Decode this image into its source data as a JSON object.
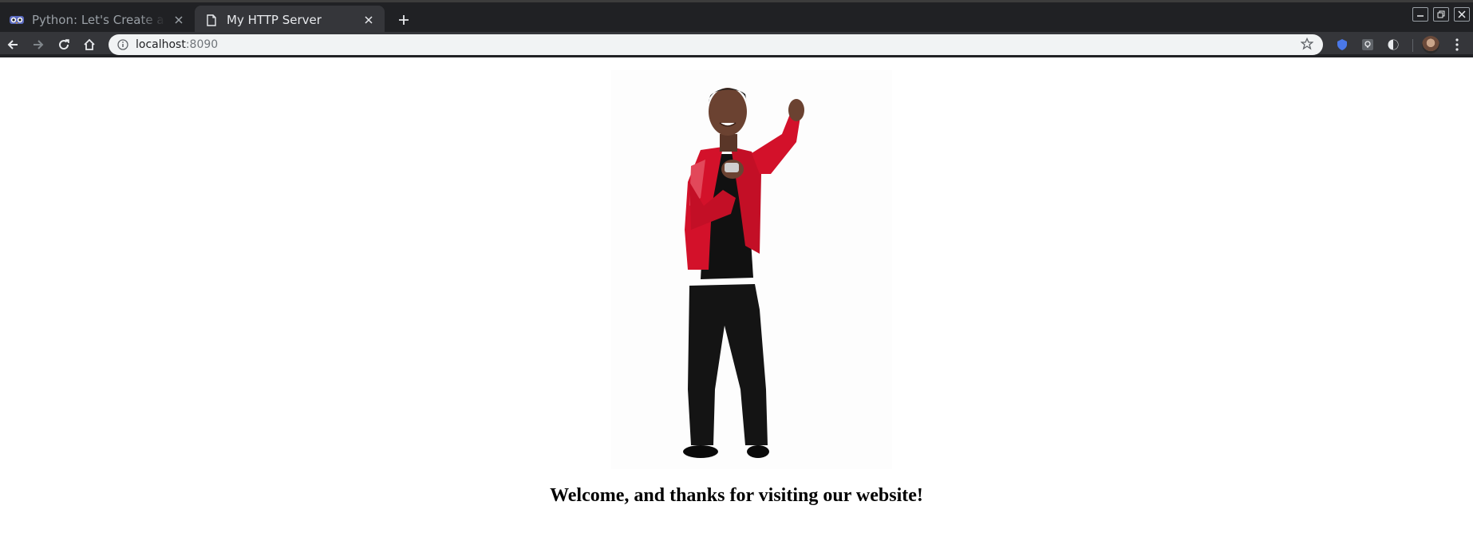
{
  "browser": {
    "tabs": [
      {
        "title": "Python: Let's Create a Sim",
        "active": false,
        "favicon": "owl-icon"
      },
      {
        "title": "My HTTP Server",
        "active": true,
        "favicon": "page-icon"
      }
    ],
    "address": {
      "host": "localhost",
      "port": ":8090"
    }
  },
  "page": {
    "image_alt": "dancing man in red jacket",
    "heading": "Welcome, and thanks for visiting our website!"
  },
  "colors": {
    "tabstrip": "#202124",
    "toolbar": "#35363a",
    "omnibox": "#f1f3f4",
    "jacket_red": "#d3112a"
  }
}
